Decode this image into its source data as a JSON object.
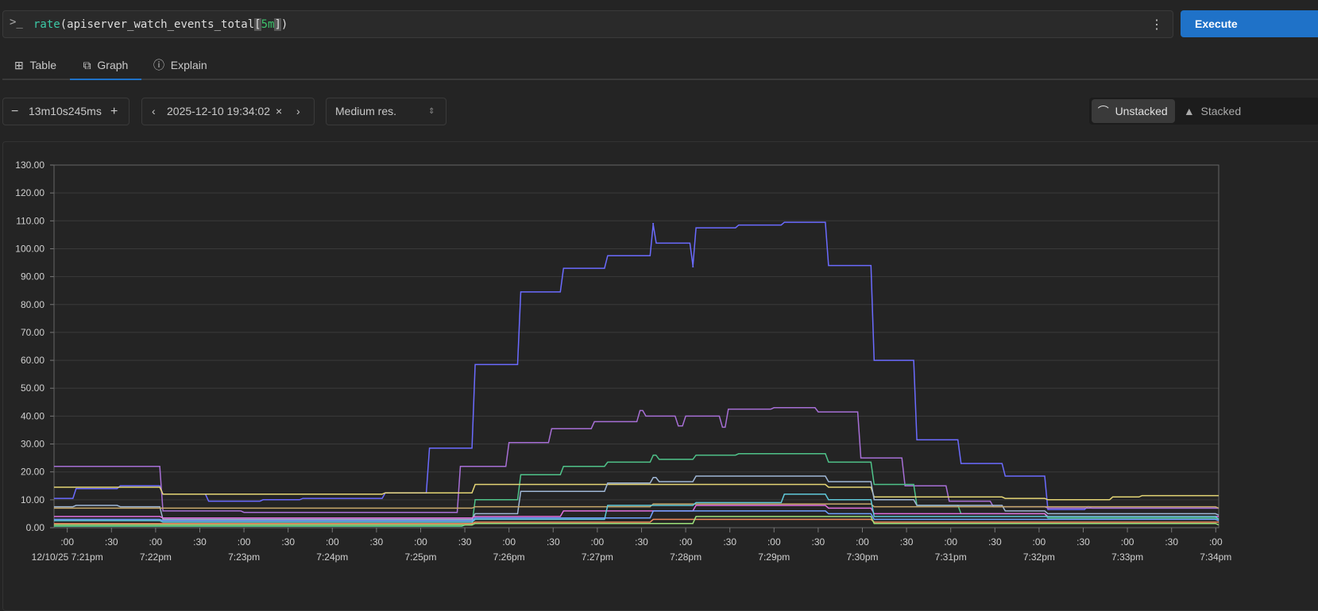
{
  "query": {
    "prompt_icon": "terminal-icon",
    "fn": "rate",
    "open": "(",
    "metric": "apiserver_watch_events_total",
    "lb": "[",
    "range": "5m",
    "rb": "]",
    "close": ")",
    "menu_icon": "kebab-icon"
  },
  "execute_label": "Execute",
  "tabs": [
    {
      "label": "Table",
      "icon": "table-icon"
    },
    {
      "label": "Graph",
      "icon": "graph-icon",
      "active": true
    },
    {
      "label": "Explain",
      "icon": "info-icon"
    }
  ],
  "controls": {
    "range": "13m10s245ms",
    "end_time": "2025-12-10 19:34:02",
    "resolution": "Medium res.",
    "unstacked": "Unstacked",
    "stacked": "Stacked",
    "mode": "unstacked"
  },
  "chart_data": {
    "type": "line",
    "ylim": [
      0,
      130
    ],
    "yticks": [
      "0.00",
      "10.00",
      "20.00",
      "30.00",
      "40.00",
      "50.00",
      "60.00",
      "70.00",
      "80.00",
      "90.00",
      "100.00",
      "110.00",
      "120.00",
      "130.00"
    ],
    "xlim": [
      "19:20:51",
      "19:34:02"
    ],
    "xticks": [
      {
        "t": "19:21:00",
        "top": ":00",
        "bottom": "12/10/25 7:21pm"
      },
      {
        "t": "19:21:30",
        "top": ":30",
        "bottom": ""
      },
      {
        "t": "19:22:00",
        "top": ":00",
        "bottom": "7:22pm"
      },
      {
        "t": "19:22:30",
        "top": ":30",
        "bottom": ""
      },
      {
        "t": "19:23:00",
        "top": ":00",
        "bottom": "7:23pm"
      },
      {
        "t": "19:23:30",
        "top": ":30",
        "bottom": ""
      },
      {
        "t": "19:24:00",
        "top": ":00",
        "bottom": "7:24pm"
      },
      {
        "t": "19:24:30",
        "top": ":30",
        "bottom": ""
      },
      {
        "t": "19:25:00",
        "top": ":00",
        "bottom": "7:25pm"
      },
      {
        "t": "19:25:30",
        "top": ":30",
        "bottom": ""
      },
      {
        "t": "19:26:00",
        "top": ":00",
        "bottom": "7:26pm"
      },
      {
        "t": "19:26:30",
        "top": ":30",
        "bottom": ""
      },
      {
        "t": "19:27:00",
        "top": ":00",
        "bottom": "7:27pm"
      },
      {
        "t": "19:27:30",
        "top": ":30",
        "bottom": ""
      },
      {
        "t": "19:28:00",
        "top": ":00",
        "bottom": "7:28pm"
      },
      {
        "t": "19:28:30",
        "top": ":30",
        "bottom": ""
      },
      {
        "t": "19:29:00",
        "top": ":00",
        "bottom": "7:29pm"
      },
      {
        "t": "19:29:30",
        "top": ":30",
        "bottom": ""
      },
      {
        "t": "19:30:00",
        "top": ":00",
        "bottom": "7:30pm"
      },
      {
        "t": "19:30:30",
        "top": ":30",
        "bottom": ""
      },
      {
        "t": "19:31:00",
        "top": ":00",
        "bottom": "7:31pm"
      },
      {
        "t": "19:31:30",
        "top": ":30",
        "bottom": ""
      },
      {
        "t": "19:32:00",
        "top": ":00",
        "bottom": "7:32pm"
      },
      {
        "t": "19:32:30",
        "top": ":30",
        "bottom": ""
      },
      {
        "t": "19:33:00",
        "top": ":00",
        "bottom": "7:33pm"
      },
      {
        "t": "19:33:30",
        "top": ":30",
        "bottom": ""
      },
      {
        "t": "19:34:00",
        "top": ":00",
        "bottom": "7:34pm"
      }
    ],
    "grid": true,
    "series": [
      {
        "color": "#6b6bff",
        "points": [
          [
            "19:20:51",
            10.5
          ],
          [
            "19:21:06",
            14
          ],
          [
            "19:21:36",
            15
          ],
          [
            "19:22:05",
            12
          ],
          [
            "19:22:36",
            9.5
          ],
          [
            "19:23:13",
            10
          ],
          [
            "19:23:40",
            10.5
          ],
          [
            "19:24:36",
            12.5
          ],
          [
            "19:25:06",
            28.5
          ],
          [
            "19:25:37",
            58.5
          ],
          [
            "19:26:08",
            84.5
          ],
          [
            "19:26:37",
            93
          ],
          [
            "19:27:07",
            97.5
          ],
          [
            "19:27:38",
            109
          ],
          [
            "19:27:40",
            102
          ],
          [
            "19:28:05",
            93.5
          ],
          [
            "19:28:07",
            107.5
          ],
          [
            "19:28:36",
            108.5
          ],
          [
            "19:29:07",
            109.5
          ],
          [
            "19:29:37",
            94
          ],
          [
            "19:30:08",
            60
          ],
          [
            "19:30:37",
            31.5
          ],
          [
            "19:31:07",
            23
          ],
          [
            "19:31:37",
            18.5
          ],
          [
            "19:32:06",
            6.5
          ],
          [
            "19:32:33",
            7.5
          ],
          [
            "19:32:36",
            7
          ],
          [
            "19:34:02",
            7
          ]
        ]
      },
      {
        "color": "#a76fd6",
        "points": [
          [
            "19:20:51",
            22
          ],
          [
            "19:22:05",
            6
          ],
          [
            "19:23:00",
            5.5
          ],
          [
            "19:25:27",
            22
          ],
          [
            "19:26:00",
            30.5
          ],
          [
            "19:26:29",
            35.5
          ],
          [
            "19:26:58",
            38
          ],
          [
            "19:27:29",
            42
          ],
          [
            "19:27:33",
            40
          ],
          [
            "19:27:55",
            36.5
          ],
          [
            "19:28:00",
            40
          ],
          [
            "19:28:25",
            36
          ],
          [
            "19:28:29",
            42.5
          ],
          [
            "19:29:00",
            43
          ],
          [
            "19:29:30",
            41.5
          ],
          [
            "19:29:59",
            25
          ],
          [
            "19:30:29",
            15
          ],
          [
            "19:30:59",
            9.5
          ],
          [
            "19:31:29",
            7.5
          ],
          [
            "19:32:06",
            7
          ],
          [
            "19:34:02",
            7
          ]
        ]
      },
      {
        "color": "#4fc38a",
        "points": [
          [
            "19:20:51",
            0.5
          ],
          [
            "19:25:30",
            1
          ],
          [
            "19:25:37",
            10
          ],
          [
            "19:26:08",
            19
          ],
          [
            "19:26:37",
            22
          ],
          [
            "19:27:07",
            23.5
          ],
          [
            "19:27:38",
            26
          ],
          [
            "19:27:42",
            24.5
          ],
          [
            "19:28:07",
            26
          ],
          [
            "19:28:36",
            26.5
          ],
          [
            "19:29:37",
            23.5
          ],
          [
            "19:30:08",
            15.5
          ],
          [
            "19:30:37",
            8
          ],
          [
            "19:31:07",
            5
          ],
          [
            "19:32:06",
            3.5
          ],
          [
            "19:34:02",
            3
          ]
        ]
      },
      {
        "color": "#e5d675",
        "points": [
          [
            "19:20:51",
            14.5
          ],
          [
            "19:22:05",
            12
          ],
          [
            "19:24:36",
            12.5
          ],
          [
            "19:25:37",
            15.5
          ],
          [
            "19:29:37",
            14.5
          ],
          [
            "19:30:08",
            11
          ],
          [
            "19:31:37",
            10.5
          ],
          [
            "19:32:06",
            10
          ],
          [
            "19:32:50",
            11
          ],
          [
            "19:33:10",
            11.5
          ],
          [
            "19:34:02",
            11.5
          ]
        ]
      },
      {
        "color": "#9fb7d6",
        "points": [
          [
            "19:20:51",
            7.5
          ],
          [
            "19:21:06",
            8
          ],
          [
            "19:21:36",
            7.5
          ],
          [
            "19:22:05",
            3
          ],
          [
            "19:25:37",
            5
          ],
          [
            "19:26:08",
            13
          ],
          [
            "19:27:07",
            16
          ],
          [
            "19:27:38",
            18
          ],
          [
            "19:27:42",
            16.5
          ],
          [
            "19:28:07",
            18.5
          ],
          [
            "19:29:37",
            16.5
          ],
          [
            "19:30:08",
            10
          ],
          [
            "19:30:37",
            8
          ],
          [
            "19:31:37",
            6
          ],
          [
            "19:32:06",
            5
          ],
          [
            "19:34:02",
            4.5
          ]
        ]
      },
      {
        "color": "#c8a96a",
        "points": [
          [
            "19:20:51",
            7
          ],
          [
            "19:25:00",
            7
          ],
          [
            "19:25:37",
            7.5
          ],
          [
            "19:27:38",
            8.5
          ],
          [
            "19:29:37",
            8.5
          ],
          [
            "19:30:08",
            7.5
          ],
          [
            "19:34:02",
            7
          ]
        ]
      },
      {
        "color": "#e070e0",
        "points": [
          [
            "19:20:51",
            4
          ],
          [
            "19:22:05",
            3.5
          ],
          [
            "19:25:37",
            4
          ],
          [
            "19:26:37",
            6
          ],
          [
            "19:28:07",
            8
          ],
          [
            "19:29:37",
            7
          ],
          [
            "19:30:08",
            5
          ],
          [
            "19:32:06",
            4
          ],
          [
            "19:34:02",
            4
          ]
        ]
      },
      {
        "color": "#5fc8d8",
        "points": [
          [
            "19:20:51",
            2.5
          ],
          [
            "19:22:05",
            2
          ],
          [
            "19:25:37",
            3
          ],
          [
            "19:27:07",
            8
          ],
          [
            "19:28:07",
            9
          ],
          [
            "19:29:07",
            12
          ],
          [
            "19:29:37",
            10
          ],
          [
            "19:30:08",
            4
          ],
          [
            "19:34:02",
            3
          ]
        ]
      },
      {
        "color": "#f08a5d",
        "points": [
          [
            "19:20:51",
            1.5
          ],
          [
            "19:25:37",
            2
          ],
          [
            "19:27:38",
            3
          ],
          [
            "19:30:08",
            2
          ],
          [
            "19:34:02",
            2
          ]
        ]
      },
      {
        "color": "#9de07a",
        "points": [
          [
            "19:20:51",
            1
          ],
          [
            "19:25:37",
            1.5
          ],
          [
            "19:28:07",
            4
          ],
          [
            "19:30:08",
            1.5
          ],
          [
            "19:34:02",
            1
          ]
        ]
      },
      {
        "color": "#6fa0ff",
        "points": [
          [
            "19:20:51",
            3
          ],
          [
            "19:22:05",
            2.5
          ],
          [
            "19:25:37",
            3.5
          ],
          [
            "19:27:38",
            6
          ],
          [
            "19:29:37",
            5
          ],
          [
            "19:30:08",
            3
          ],
          [
            "19:34:02",
            2.5
          ]
        ]
      }
    ]
  }
}
